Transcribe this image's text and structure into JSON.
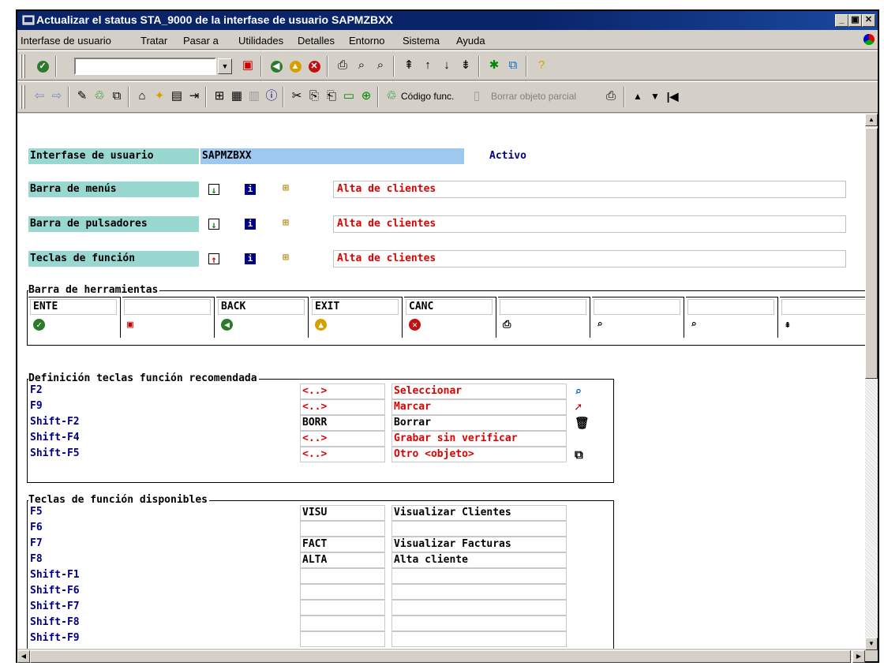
{
  "window": {
    "title": "Actualizar el status STA_9000 de la interfase de usuario SAPMZBXX"
  },
  "menu": [
    "Interfase de usuario",
    "Tratar",
    "Pasar a",
    "Utilidades",
    "Detalles",
    "Entorno",
    "Sistema",
    "Ayuda"
  ],
  "toolbar": {
    "command_value": "",
    "codigo_func_label": "Código func.",
    "borrar_label": "Borrar objeto parcial"
  },
  "header": {
    "label": "Interfase de usuario",
    "value": "SAPMZBXX",
    "status": "Activo"
  },
  "bars": [
    {
      "label": "Barra de menús",
      "value": "Alta de clientes"
    },
    {
      "label": "Barra de pulsadores",
      "value": "Alta de clientes"
    },
    {
      "label": "Teclas de función",
      "value": "Alta de clientes"
    }
  ],
  "herramientas": {
    "title": "Barra de herramientas",
    "cells": [
      {
        "code": "ENTE",
        "icon": "check-icon"
      },
      {
        "code": "",
        "icon": "save-icon"
      },
      {
        "code": "BACK",
        "icon": "back-icon"
      },
      {
        "code": "EXIT",
        "icon": "exit-icon"
      },
      {
        "code": "CANC",
        "icon": "cancel-icon"
      },
      {
        "code": "",
        "icon": "print-icon"
      },
      {
        "code": "",
        "icon": "find-icon"
      },
      {
        "code": "",
        "icon": "find-next-icon"
      },
      {
        "code": "",
        "icon": "first-page-icon"
      }
    ]
  },
  "recomendada": {
    "title": "Definición teclas función recomendada",
    "rows": [
      {
        "key": "F2",
        "code": "<..>",
        "text": "Seleccionar",
        "icon": "select-icon"
      },
      {
        "key": "F9",
        "code": "<..>",
        "text": "Marcar",
        "icon": "mark-icon"
      },
      {
        "key": "Shift-F2",
        "code": "BORR",
        "text": "Borrar",
        "icon": "trash-icon"
      },
      {
        "key": "Shift-F4",
        "code": "<..>",
        "text": "Grabar sin verificar",
        "icon": ""
      },
      {
        "key": "Shift-F5",
        "code": "<..>",
        "text": "Otro <objeto>",
        "icon": "other-object-icon"
      }
    ]
  },
  "disponibles": {
    "title": "Teclas de función disponibles",
    "rows": [
      {
        "key": "F5",
        "code": "VISU",
        "text": "Visualizar Clientes"
      },
      {
        "key": "F6",
        "code": "",
        "text": ""
      },
      {
        "key": "F7",
        "code": "FACT",
        "text": "Visualizar Facturas"
      },
      {
        "key": "F8",
        "code": "ALTA",
        "text": "Alta cliente"
      },
      {
        "key": "Shift-F1",
        "code": "",
        "text": ""
      },
      {
        "key": "Shift-F6",
        "code": "",
        "text": ""
      },
      {
        "key": "Shift-F7",
        "code": "",
        "text": ""
      },
      {
        "key": "Shift-F8",
        "code": "",
        "text": ""
      },
      {
        "key": "Shift-F9",
        "code": "",
        "text": ""
      }
    ]
  }
}
